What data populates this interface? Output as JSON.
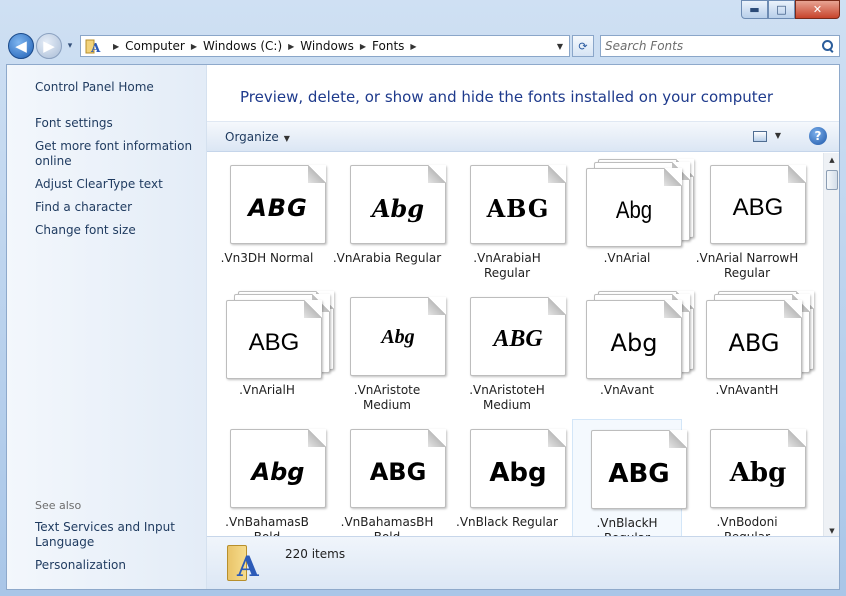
{
  "window": {
    "minimize_glyph": "▬",
    "maximize_glyph": "□",
    "close_glyph": "✕"
  },
  "nav": {
    "back_glyph": "◀",
    "forward_glyph": "▶",
    "history_glyph": "▾",
    "breadcrumb": [
      "Computer",
      "Windows (C:)",
      "Windows",
      "Fonts"
    ],
    "refresh_glyph": "⟳",
    "search_placeholder": "Search Fonts"
  },
  "sidebar": {
    "home": "Control Panel Home",
    "links": [
      "Font settings",
      "Get more font information online",
      "Adjust ClearType text",
      "Find a character",
      "Change font size"
    ],
    "see_also_label": "See also",
    "see_also_links": [
      "Text Services and Input Language",
      "Personalization"
    ]
  },
  "header": {
    "title": "Preview, delete, or show and hide the fonts installed on your computer"
  },
  "toolbar": {
    "organize": "Organize",
    "organize_arrow": "▼",
    "view_arrow": "▼",
    "help": "?"
  },
  "fonts": [
    {
      "name": ".Vn3DH Normal",
      "sample": "ABG",
      "stack": false
    },
    {
      "name": ".VnArabia Regular",
      "sample": "Abg",
      "stack": false
    },
    {
      "name": ".VnArabiaH Regular",
      "sample": "ABG",
      "stack": false
    },
    {
      "name": ".VnArial",
      "sample": "Abg",
      "stack": true
    },
    {
      "name": ".VnArial NarrowH Regular",
      "sample": "ABG",
      "stack": false
    },
    {
      "name": ".VnArialH",
      "sample": "ABG",
      "stack": true
    },
    {
      "name": ".VnAristote Medium",
      "sample": "Abg",
      "stack": false
    },
    {
      "name": ".VnAristoteH Medium",
      "sample": "ABG",
      "stack": false
    },
    {
      "name": ".VnAvant",
      "sample": "Abg",
      "stack": true
    },
    {
      "name": ".VnAvantH",
      "sample": "ABG",
      "stack": true
    },
    {
      "name": ".VnBahamasB Bold",
      "sample": "Abg",
      "stack": false
    },
    {
      "name": ".VnBahamasBH Bold",
      "sample": "ABG",
      "stack": false
    },
    {
      "name": ".VnBlack Regular",
      "sample": "Abg",
      "stack": false
    },
    {
      "name": ".VnBlackH Regular",
      "sample": "ABG",
      "stack": false
    },
    {
      "name": ".VnBodoni Regular",
      "sample": "Abg",
      "stack": false
    }
  ],
  "details": {
    "item_count": "220 items"
  },
  "scrollbar": {
    "up_glyph": "▲",
    "down_glyph": "▼"
  }
}
